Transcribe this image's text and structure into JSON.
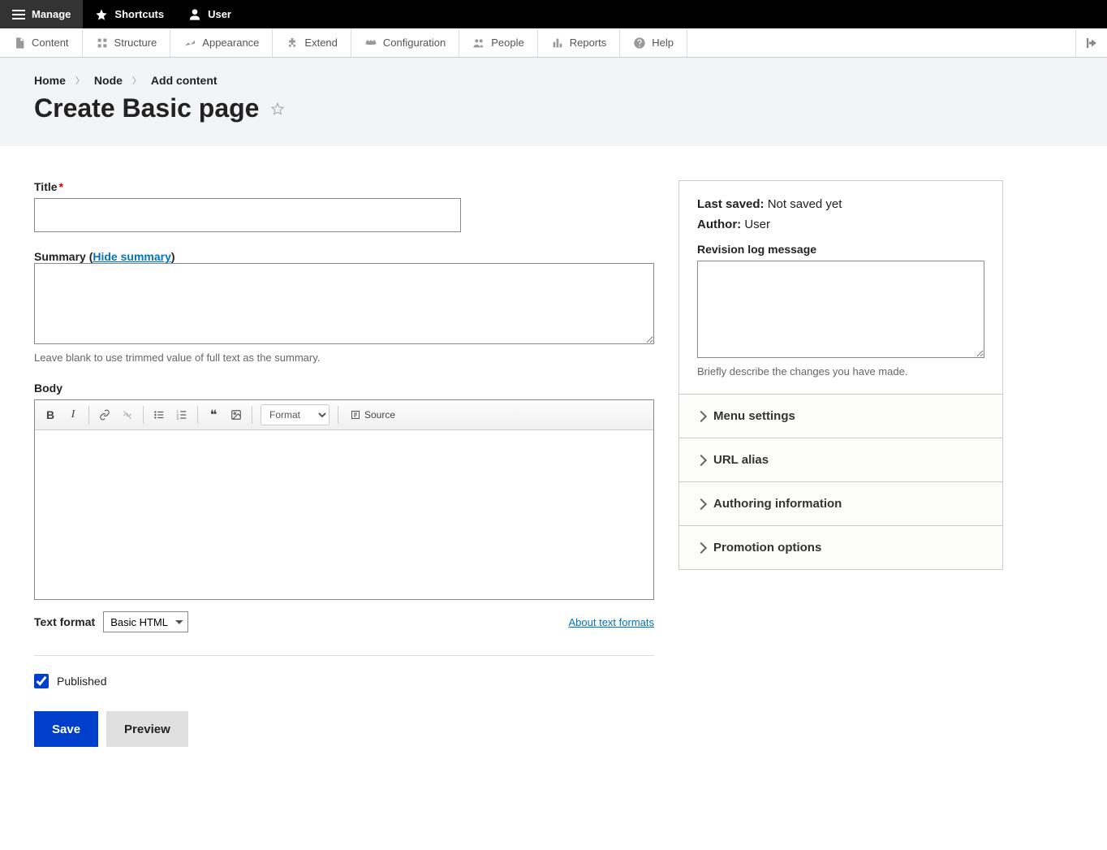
{
  "toolbar": {
    "manage": "Manage",
    "shortcuts": "Shortcuts",
    "user": "User"
  },
  "adminMenu": [
    {
      "label": "Content"
    },
    {
      "label": "Structure"
    },
    {
      "label": "Appearance"
    },
    {
      "label": "Extend"
    },
    {
      "label": "Configuration"
    },
    {
      "label": "People"
    },
    {
      "label": "Reports"
    },
    {
      "label": "Help"
    }
  ],
  "breadcrumb": {
    "home": "Home",
    "node": "Node",
    "add": "Add content"
  },
  "pageTitle": "Create Basic page",
  "form": {
    "titleLabel": "Title",
    "summaryLabel": "Summary",
    "hideSummary": "Hide summary",
    "summaryHelp": "Leave blank to use trimmed value of full text as the summary.",
    "bodyLabel": "Body",
    "editorFormat": "Format",
    "editorSource": "Source",
    "textFormatLabel": "Text format",
    "textFormatValue": "Basic HTML",
    "aboutTextFormats": "About text formats",
    "publishedLabel": "Published",
    "saveLabel": "Save",
    "previewLabel": "Preview"
  },
  "sidebar": {
    "lastSavedLabel": "Last saved:",
    "lastSavedValue": "Not saved yet",
    "authorLabel": "Author:",
    "authorValue": "User",
    "revisionLabel": "Revision log message",
    "revisionHelp": "Briefly describe the changes you have made.",
    "accordion": [
      "Menu settings",
      "URL alias",
      "Authoring information",
      "Promotion options"
    ]
  }
}
